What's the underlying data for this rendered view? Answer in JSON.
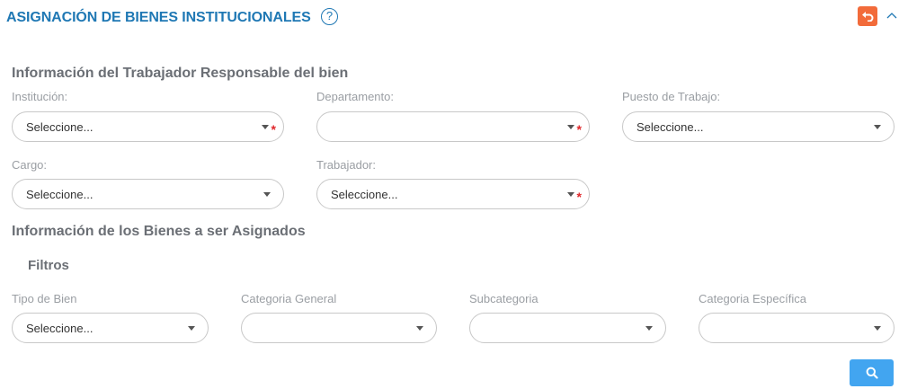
{
  "header": {
    "title": "ASIGNACIÓN DE BIENES INSTITUCIONALES",
    "help_glyph": "?",
    "back_icon": "undo-arrow-icon",
    "collapse_icon": "chevron-up-icon",
    "back_color": "#f26b3a",
    "title_color": "#1f78b4"
  },
  "worker_section": {
    "title": "Información del Trabajador Responsable del bien",
    "institucion": {
      "label": "Institución:",
      "value": "Seleccione...",
      "required": true
    },
    "departamento": {
      "label": "Departamento:",
      "value": "",
      "required": true
    },
    "puesto": {
      "label": "Puesto de Trabajo:",
      "value": "Seleccione...",
      "required": false
    },
    "cargo": {
      "label": "Cargo:",
      "value": "Seleccione...",
      "required": false
    },
    "trabajador": {
      "label": "Trabajador:",
      "value": "Seleccione...",
      "required": true
    },
    "required_mark": "*"
  },
  "assets_section": {
    "title": "Información de los Bienes a ser Asignados",
    "filters_title": "Filtros",
    "tipo_bien": {
      "label": "Tipo de Bien",
      "value": "Seleccione..."
    },
    "categoria_general": {
      "label": "Categoria General",
      "value": ""
    },
    "subcategoria": {
      "label": "Subcategoria",
      "value": ""
    },
    "categoria_especifica": {
      "label": "Categoria Específica",
      "value": ""
    },
    "search_icon": "search-icon",
    "search_color": "#42a5f0"
  }
}
